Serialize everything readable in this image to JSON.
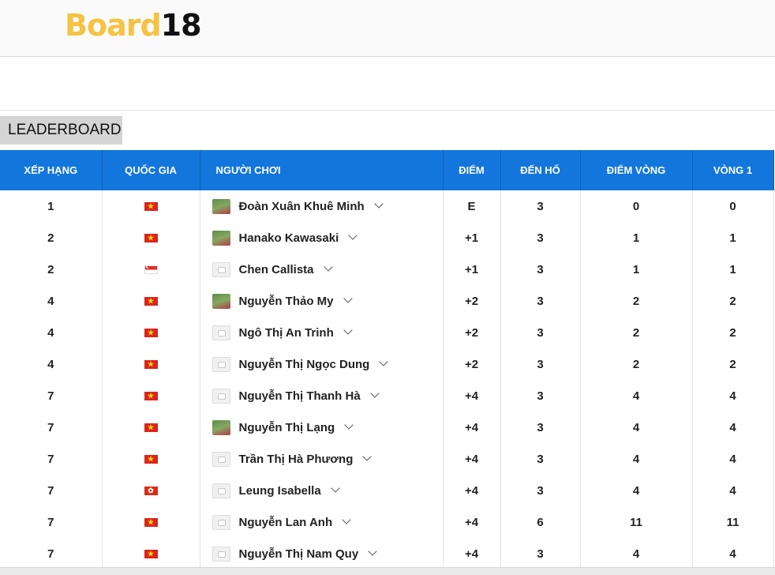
{
  "brand": {
    "logo_part1": "Board",
    "logo_part2": "18"
  },
  "leaderboard_tab": "LEADERBOARD",
  "columns": {
    "rank": "XẾP HẠNG",
    "country": "QUỐC GIA",
    "player": "NGƯỜI CHƠI",
    "score": "ĐIỂM",
    "thru": "ĐẾN HỐ",
    "round_score": "ĐIỂM VÒNG",
    "round1": "VÒNG 1"
  },
  "rows": [
    {
      "rank": "1",
      "flag": "vn-flag-icon",
      "avatar": "photo",
      "player": "Đoàn Xuân Khuê Minh",
      "score": "E",
      "thru": "3",
      "round_score": "0",
      "round1": "0"
    },
    {
      "rank": "2",
      "flag": "vn-flag-icon",
      "avatar": "photo",
      "player": "Hanako Kawasaki",
      "score": "+1",
      "thru": "3",
      "round_score": "1",
      "round1": "1"
    },
    {
      "rank": "2",
      "flag": "sg-flag-icon",
      "avatar": "placeholder",
      "player": "Chen Callista",
      "score": "+1",
      "thru": "3",
      "round_score": "1",
      "round1": "1"
    },
    {
      "rank": "4",
      "flag": "vn-flag-icon",
      "avatar": "photo",
      "player": "Nguyễn Thảo My",
      "score": "+2",
      "thru": "3",
      "round_score": "2",
      "round1": "2"
    },
    {
      "rank": "4",
      "flag": "vn-flag-icon",
      "avatar": "placeholder",
      "player": "Ngô Thị An Trinh",
      "score": "+2",
      "thru": "3",
      "round_score": "2",
      "round1": "2"
    },
    {
      "rank": "4",
      "flag": "vn-flag-icon",
      "avatar": "placeholder",
      "player": "Nguyễn Thị Ngọc Dung",
      "score": "+2",
      "thru": "3",
      "round_score": "2",
      "round1": "2"
    },
    {
      "rank": "7",
      "flag": "vn-flag-icon",
      "avatar": "placeholder",
      "player": "Nguyễn Thị Thanh Hà",
      "score": "+4",
      "thru": "3",
      "round_score": "4",
      "round1": "4"
    },
    {
      "rank": "7",
      "flag": "vn-flag-icon",
      "avatar": "photo",
      "player": "Nguyễn Thị Lạng",
      "score": "+4",
      "thru": "3",
      "round_score": "4",
      "round1": "4"
    },
    {
      "rank": "7",
      "flag": "vn-flag-icon",
      "avatar": "placeholder",
      "player": "Trần Thị Hà Phương",
      "score": "+4",
      "thru": "3",
      "round_score": "4",
      "round1": "4"
    },
    {
      "rank": "7",
      "flag": "hk-flag-icon",
      "avatar": "placeholder",
      "player": "Leung Isabella",
      "score": "+4",
      "thru": "3",
      "round_score": "4",
      "round1": "4"
    },
    {
      "rank": "7",
      "flag": "vn-flag-icon",
      "avatar": "placeholder",
      "player": "Nguyễn Lan Anh",
      "score": "+4",
      "thru": "6",
      "round_score": "11",
      "round1": "11"
    },
    {
      "rank": "7",
      "flag": "vn-flag-icon",
      "avatar": "placeholder",
      "player": "Nguyễn Thị Nam Quy",
      "score": "+4",
      "thru": "3",
      "round_score": "4",
      "round1": "4"
    }
  ]
}
